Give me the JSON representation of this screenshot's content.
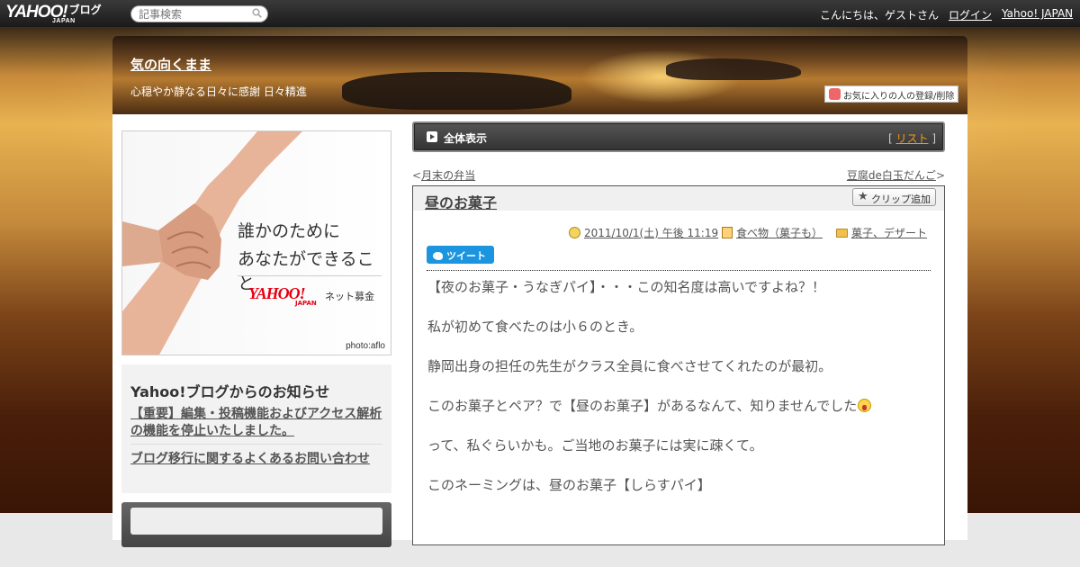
{
  "topbar": {
    "logo": "YAHOO!",
    "logo_sub": "JAPAN",
    "logo_blog": "ブログ",
    "search_placeholder": "記事検索",
    "greeting": "こんにちは、ゲストさん",
    "login": "ログイン",
    "yahoo_japan": "Yahoo! JAPAN"
  },
  "header": {
    "title": "気の向くまま",
    "subtitle": "心穏やか静なる日々に感謝 日々精進",
    "fav_button": "お気に入りの人の登録/削除"
  },
  "sidebar": {
    "ad": {
      "line1": "誰かのために",
      "line2": "あなたができること",
      "logo": "YAHOO!",
      "logo_sub": "JAPAN",
      "service": "ネット募金",
      "credit": "photo:aflo"
    },
    "notice": {
      "title": "Yahoo!ブログからのお知らせ",
      "items": [
        "【重要】編集・投稿機能およびアクセス解析の機能を停止いたしました。",
        "ブログ移行に関するよくあるお問い合わせ"
      ]
    }
  },
  "main": {
    "all_label": "全体表示",
    "list_link": "リスト",
    "nav_prev": "月末の弁当",
    "nav_next": "豆腐de白玉だんご",
    "article": {
      "title": "昼のお菓子",
      "clip_button": "クリップ追加",
      "date": "2011/10/1(土) 午後 11:19",
      "category": "食べ物（菓子も）",
      "tag": "菓子、デザート",
      "tweet": "ツイート",
      "paragraphs": [
        "【夜のお菓子・うなぎパイ】・・・この知名度は高いですよね？！",
        "私が初めて食べたのは小６のとき。",
        "静岡出身の担任の先生がクラス全員に食べさせてくれたのが最初。",
        "このお菓子とペア？で【昼のお菓子】があるなんて、知りませんでした",
        "って、私ぐらいかも。ご当地のお菓子には実に疎くて。",
        "このネーミングは、昼のお菓子【しらすパイ】"
      ]
    }
  }
}
